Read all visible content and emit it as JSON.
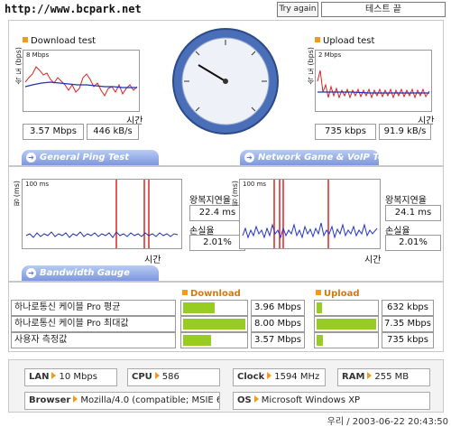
{
  "header": {
    "url": "http://www.bcpark.net",
    "try_again": "Try again",
    "status": "테스트 끝"
  },
  "download": {
    "title": "Download test",
    "scale": "8 Mbps",
    "ylabel": "속 도 (bps)",
    "xlabel": "시간",
    "mbps": "3.57 Mbps",
    "kbs": "446 kB/s"
  },
  "upload": {
    "title": "Upload test",
    "scale": "2 Mbps",
    "ylabel": "속 도 (bps)",
    "xlabel": "시간",
    "kbps": "735 kbps",
    "kbs": "91.9 kB/s"
  },
  "tabs": {
    "ping": "General Ping Test",
    "game": "Network Game & VoIP Test",
    "gauge": "Bandwidth Gauge"
  },
  "ping": {
    "scale": "100 ms",
    "ylabel": "핑 (ms)",
    "xlabel": "시간",
    "latency_label": "왕복지연율",
    "latency": "22.4 ms",
    "loss_label": "손실율",
    "loss": "2.01%"
  },
  "game": {
    "scale": "100 ms",
    "ylabel": "핑 (ms)",
    "xlabel": "시간",
    "latency_label": "왕복지연율",
    "latency": "24.1 ms",
    "loss_label": "손실율",
    "loss": "2.01%"
  },
  "gauge_table": {
    "download_header": "Download",
    "upload_header": "Upload",
    "rows": [
      {
        "label": "하나로통신 케이블 Pro 평균",
        "dl": "3.96 Mbps",
        "dl_fill": 0.5,
        "ul": "632 kbps",
        "ul_fill": 0.09
      },
      {
        "label": "하나로통신 케이블 Pro 최대값",
        "dl": "8.00 Mbps",
        "dl_fill": 1.0,
        "ul": "7.35 Mbps",
        "ul_fill": 1.0
      },
      {
        "label": "사용자 측정값",
        "dl": "3.57 Mbps",
        "dl_fill": 0.45,
        "ul": "735 kbps",
        "ul_fill": 0.1
      }
    ]
  },
  "system": {
    "lan_label": "LAN",
    "lan": "10 Mbps",
    "cpu_label": "CPU",
    "cpu": "586",
    "clock_label": "Clock",
    "clock": "1594 MHz",
    "ram_label": "RAM",
    "ram": "255 MB",
    "browser_label": "Browser",
    "browser": "Mozilla/4.0 (compatible; MSIE 6.0",
    "os_label": "OS",
    "os": "Microsoft Windows XP"
  },
  "footer": "우리 / 2003-06-22 20:43:50",
  "gauge_dial": {
    "labels": [
      "100K",
      "200K",
      "300K",
      "500K",
      "1M",
      "2M",
      "5M",
      "10M"
    ],
    "needle_value": "3.57 Mbps"
  },
  "colors": {
    "download_line": "#dd2222",
    "avg_line": "#2233aa",
    "tab": "#7c97e0",
    "bar": "#99cc22",
    "accent": "#f29a1a"
  }
}
